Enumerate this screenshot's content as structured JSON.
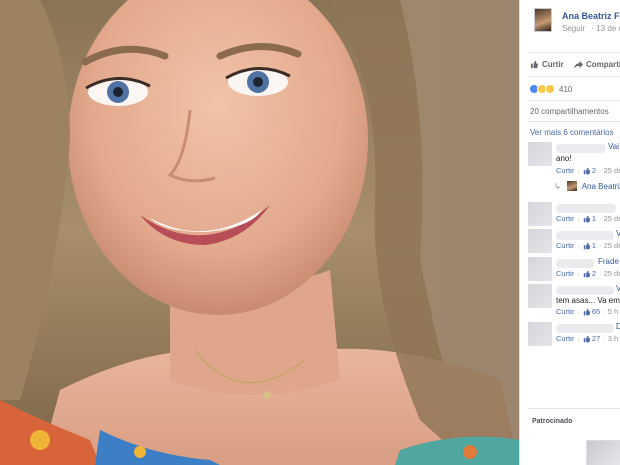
{
  "photo": {
    "alt": "selfie-photo"
  },
  "post": {
    "author": "Ana Beatriz F",
    "follow_label": "Seguir",
    "date": "· 13 de out"
  },
  "actions": {
    "like_label": "Curtir",
    "share_label": "Compartil"
  },
  "reactions": {
    "count": "410"
  },
  "shares_text": "20 compartilhamentos",
  "more_comments": "Ver mais 6 comentários",
  "comments": [
    {
      "name": "Vai",
      "text": "ano!",
      "like": "Curtir",
      "count": "2",
      "time": "· 25 de"
    },
    {
      "name": "",
      "text": "",
      "like": "Curtir",
      "count": "1",
      "time": "· 25 de"
    },
    {
      "name": "V",
      "text": "",
      "like": "Curtir",
      "count": "1",
      "time": "· 25 de"
    },
    {
      "name": "Frade",
      "text": "",
      "like": "Curtir",
      "count": "2",
      "time": "· 25 de"
    },
    {
      "name": "V",
      "text": "tem asas... Va em p",
      "like": "Curtir",
      "count": "65",
      "time": "· 5 h"
    },
    {
      "name": "D",
      "text": "",
      "like": "Curtir",
      "count": "27",
      "time": "· 3 h"
    }
  ],
  "reply": {
    "name": "Ana Beatriz F"
  },
  "sponsored_label": "Patrocinado",
  "colors": {
    "link": "#365899",
    "muted": "#90949c",
    "like_blue": "#4e86f2",
    "wow_yellow": "#f7c94b"
  }
}
